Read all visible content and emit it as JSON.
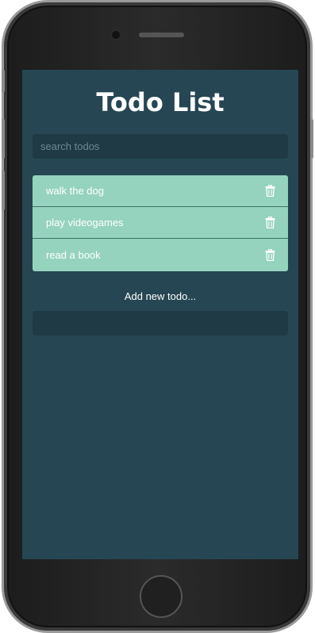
{
  "app": {
    "title": "Todo List"
  },
  "search": {
    "placeholder": "search todos",
    "value": ""
  },
  "todos": [
    {
      "label": "walk the dog",
      "icon": "trash-icon"
    },
    {
      "label": "play videogames",
      "icon": "trash-icon"
    },
    {
      "label": "read a book",
      "icon": "trash-icon"
    }
  ],
  "add": {
    "label": "Add new todo...",
    "value": ""
  },
  "colors": {
    "background": "#264653",
    "item": "#95d3be",
    "input": "#1f3a44",
    "text": "#ffffff"
  }
}
